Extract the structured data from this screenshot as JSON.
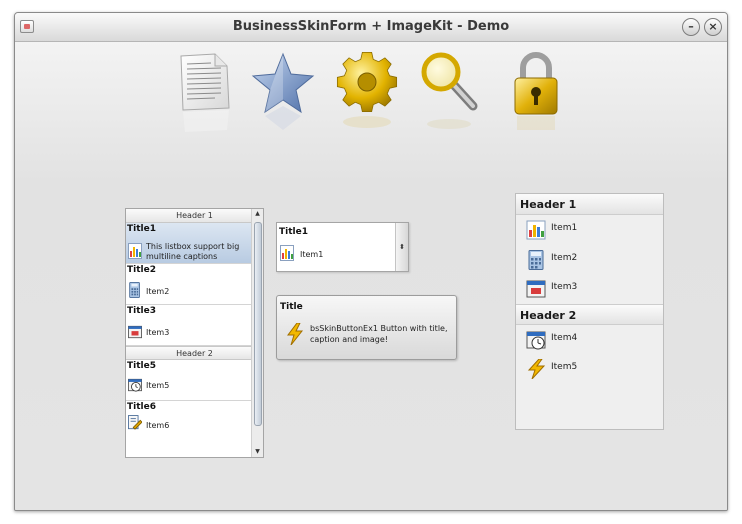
{
  "window": {
    "title": "BusinessSkinForm + ImageKit - Demo",
    "minimize_glyph": "–",
    "close_glyph": "×"
  },
  "toolbar_icons": [
    "document-icon",
    "star-icon",
    "gear-icon",
    "magnifier-icon",
    "padlock-icon"
  ],
  "listbox": {
    "groups": [
      {
        "header": "Header 1",
        "items": [
          {
            "title": "Title1",
            "caption_line1": "This listbox support big",
            "caption_line2": "multiline captions",
            "icon": "chart-icon",
            "selected": true
          },
          {
            "title": "Title2",
            "caption_line1": "Item2",
            "icon": "calculator-icon"
          },
          {
            "title": "Title3",
            "caption_line1": "Item3",
            "icon": "window-icon"
          }
        ]
      },
      {
        "header": "Header 2",
        "items": [
          {
            "title": "Title5",
            "caption_line1": "Item5",
            "icon": "clock-icon"
          },
          {
            "title": "Title6",
            "caption_line1": "Item6",
            "icon": "edit-icon"
          }
        ]
      }
    ],
    "scroll_up": "▲",
    "scroll_down": "▼"
  },
  "combobox": {
    "title": "Title1",
    "caption": "Item1",
    "icon": "chart-icon",
    "spin_glyph": "⬍"
  },
  "button": {
    "title": "Title",
    "caption": "bsSkinButtonEx1 Button with title, caption and image!",
    "icon": "lightning-icon"
  },
  "panel": {
    "header1": "Header 1",
    "header2": "Header 2",
    "items": [
      "Item1",
      "Item2",
      "Item3",
      "Item4",
      "Item5"
    ]
  },
  "colors": {
    "selection": "#c4d4e8",
    "accent_gold": "#e0b000",
    "star_blue": "#6c8ec8"
  }
}
